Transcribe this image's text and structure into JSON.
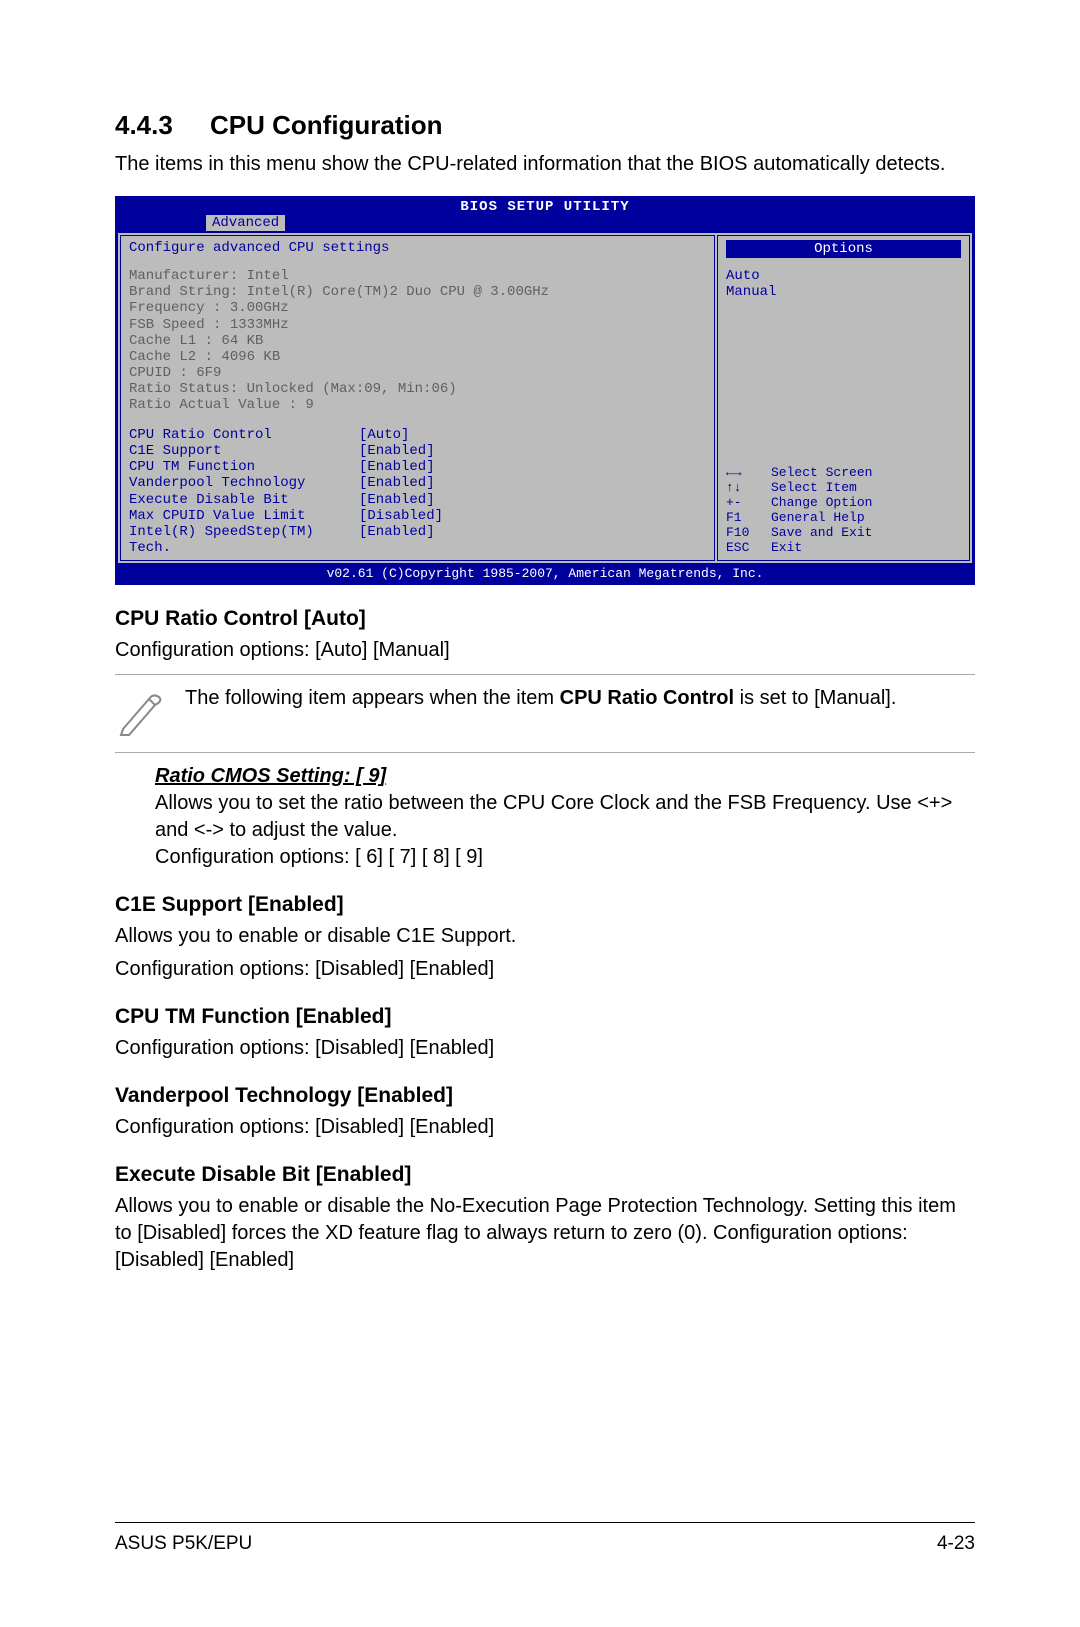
{
  "section": {
    "number": "4.4.3",
    "title": "CPU Configuration",
    "intro": "The items in this menu show the CPU-related information that the BIOS automatically detects."
  },
  "bios": {
    "title": "BIOS SETUP UTILITY",
    "tab": "Advanced",
    "left_header": "Configure advanced CPU settings",
    "info": {
      "l1": "Manufacturer: Intel",
      "l2": "Brand String: Intel(R) Core(TM)2 Duo CPU @ 3.00GHz",
      "l3": "Frequency   : 3.00GHz",
      "l4": "FSB Speed   : 1333MHz",
      "l5": "Cache L1    : 64 KB",
      "l6": "Cache L2    : 4096 KB",
      "l7": "CPUID       : 6F9",
      "l8": "Ratio Status: Unlocked (Max:09, Min:06)",
      "l9": "Ratio Actual Value : 9"
    },
    "settings": [
      {
        "label": "CPU Ratio Control",
        "value": "[Auto]"
      },
      {
        "label": "C1E Support",
        "value": "[Enabled]"
      },
      {
        "label": "CPU TM Function",
        "value": "[Enabled]"
      },
      {
        "label": "Vanderpool Technology",
        "value": "[Enabled]"
      },
      {
        "label": "Execute Disable Bit",
        "value": "[Enabled]"
      },
      {
        "label": "Max CPUID Value Limit",
        "value": "[Disabled]"
      },
      {
        "label": "Intel(R) SpeedStep(TM) Tech.",
        "value": "[Enabled]"
      }
    ],
    "options": {
      "title": "Options",
      "o1": "Auto",
      "o2": "Manual"
    },
    "nav": [
      {
        "k": "←→",
        "t": "Select Screen"
      },
      {
        "k": "↑↓",
        "t": "Select Item"
      },
      {
        "k": "+-",
        "t": "Change Option"
      },
      {
        "k": "F1",
        "t": "General Help"
      },
      {
        "k": "F10",
        "t": "Save and Exit"
      },
      {
        "k": "ESC",
        "t": "Exit"
      }
    ],
    "footer": "v02.61 (C)Copyright 1985-2007, American Megatrends, Inc."
  },
  "settings_doc": {
    "cpu_ratio": {
      "title": "CPU Ratio Control [Auto]",
      "desc": "Configuration options: [Auto] [Manual]"
    },
    "note": {
      "pre": "The following item appears when the item ",
      "bold": "CPU Ratio Control",
      "post": " is set to [Manual]."
    },
    "ratio_cmos": {
      "heading": "Ratio CMOS Setting: [ 9]",
      "l1": "Allows you to set the ratio between the CPU Core Clock and the FSB Frequency. Use <+> and <-> to adjust the value.",
      "l2": "Configuration options: [ 6] [ 7] [ 8] [ 9]"
    },
    "c1e": {
      "title": "C1E Support [Enabled]",
      "l1": "Allows you to enable or disable C1E Support.",
      "l2": "Configuration options: [Disabled] [Enabled]"
    },
    "cputm": {
      "title": "CPU TM Function [Enabled]",
      "desc": "Configuration options: [Disabled] [Enabled]"
    },
    "vanderpool": {
      "title": "Vanderpool Technology [Enabled]",
      "desc": "Configuration options: [Disabled] [Enabled]"
    },
    "execute": {
      "title": "Execute Disable Bit [Enabled]",
      "desc": "Allows you to enable or disable the No-Execution Page Protection Technology. Setting this item to [Disabled] forces the XD feature flag to always return to zero (0). Configuration options: [Disabled] [Enabled]"
    }
  },
  "footer": {
    "left": "ASUS P5K/EPU",
    "right": "4-23"
  }
}
